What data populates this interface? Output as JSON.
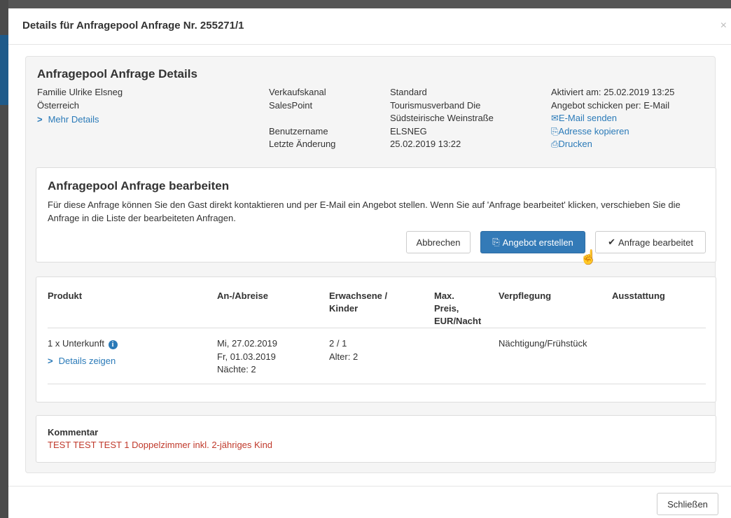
{
  "modal": {
    "title": "Details für Anfragepool Anfrage Nr. 255271/1",
    "close_glyph": "×"
  },
  "details": {
    "title": "Anfragepool Anfrage Details",
    "guest_name": "Familie Ulrike Elsneg",
    "country": "Österreich",
    "more_details": "Mehr Details",
    "labels": {
      "sales_channel": "Verkaufskanal",
      "salespoint": "SalesPoint",
      "username": "Benutzername",
      "last_change": "Letzte Änderung"
    },
    "values": {
      "sales_channel": "Standard",
      "salespoint_line1": "Tourismusverband Die",
      "salespoint_line2": "Südsteirische Weinstraße",
      "username": "ELSNEG",
      "last_change": "25.02.2019 13:22"
    },
    "activated": "Aktiviert am: 25.02.2019 13:25",
    "send_offer_via": "Angebot schicken per: E-Mail",
    "actions": {
      "send_email": "E-Mail senden",
      "copy_address": "Adresse kopieren",
      "print": "Drucken"
    }
  },
  "edit": {
    "title": "Anfragepool Anfrage bearbeiten",
    "description": "Für diese Anfrage können Sie den Gast direkt kontaktieren und per E-Mail ein Angebot stellen. Wenn Sie auf 'Anfrage bearbeitet' klicken, verschieben Sie die Anfrage in die Liste der bearbeiteten Anfragen.",
    "cancel_label": "Abbrechen",
    "create_offer_label": "Angebot erstellen",
    "processed_label": "Anfrage bearbeitet"
  },
  "table": {
    "headers": {
      "product": "Produkt",
      "arrival": "An-/Abreise",
      "adults_line1": "Erwachsene /",
      "adults_line2": "Kinder",
      "maxprice_line1": "Max.",
      "maxprice_line2": "Preis,",
      "maxprice_line3": "EUR/Nacht",
      "board": "Verpflegung",
      "equipment": "Ausstattung"
    },
    "row": {
      "product": "1 x Unterkunft",
      "show_details": "Details zeigen",
      "arrival": "Mi, 27.02.2019",
      "departure": "Fr, 01.03.2019",
      "nights": "Nächte: 2",
      "persons": "2 / 1",
      "ages": "Alter: 2",
      "board": "Nächtigung/Frühstück"
    }
  },
  "comment": {
    "title": "Kommentar",
    "text": "TEST TEST TEST 1 Doppelzimmer inkl. 2-jähriges Kind"
  },
  "footer": {
    "close_label": "Schließen"
  },
  "colors": {
    "primary": "#337ab7",
    "link": "#2a7ab8",
    "comment": "#c0392b"
  }
}
